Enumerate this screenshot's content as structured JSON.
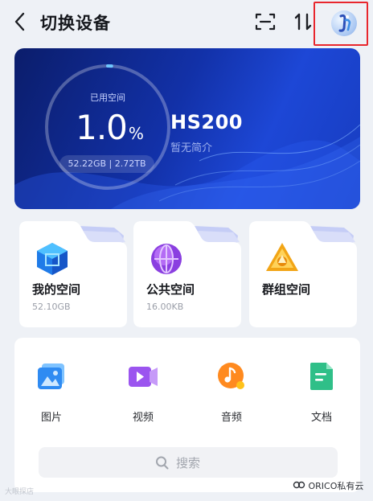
{
  "header": {
    "title": "切换设备"
  },
  "device": {
    "used_label": "已用空间",
    "usage_value": "1.0",
    "usage_unit": "%",
    "usage_percent": 1.0,
    "capacity": "52.22GB | 2.72TB",
    "name": "HS200",
    "description": "暂无简介"
  },
  "spaces": [
    {
      "title": "我的空间",
      "size": "52.10GB",
      "icon": "cube-icon"
    },
    {
      "title": "公共空间",
      "size": "16.00KB",
      "icon": "globe-icon"
    },
    {
      "title": "群组空间",
      "size": "",
      "icon": "triangle-group-icon"
    }
  ],
  "media": [
    {
      "label": "图片",
      "icon": "image-icon"
    },
    {
      "label": "视频",
      "icon": "video-icon"
    },
    {
      "label": "音频",
      "icon": "music-icon"
    },
    {
      "label": "文档",
      "icon": "document-icon"
    }
  ],
  "search": {
    "placeholder": "搜索"
  },
  "watermark": {
    "left": "大眼探店",
    "right": "ORICO私有云"
  },
  "colors": {
    "highlight_red": "#e8262d",
    "card_blue": "#1231a8",
    "background": "#eef1f6"
  }
}
